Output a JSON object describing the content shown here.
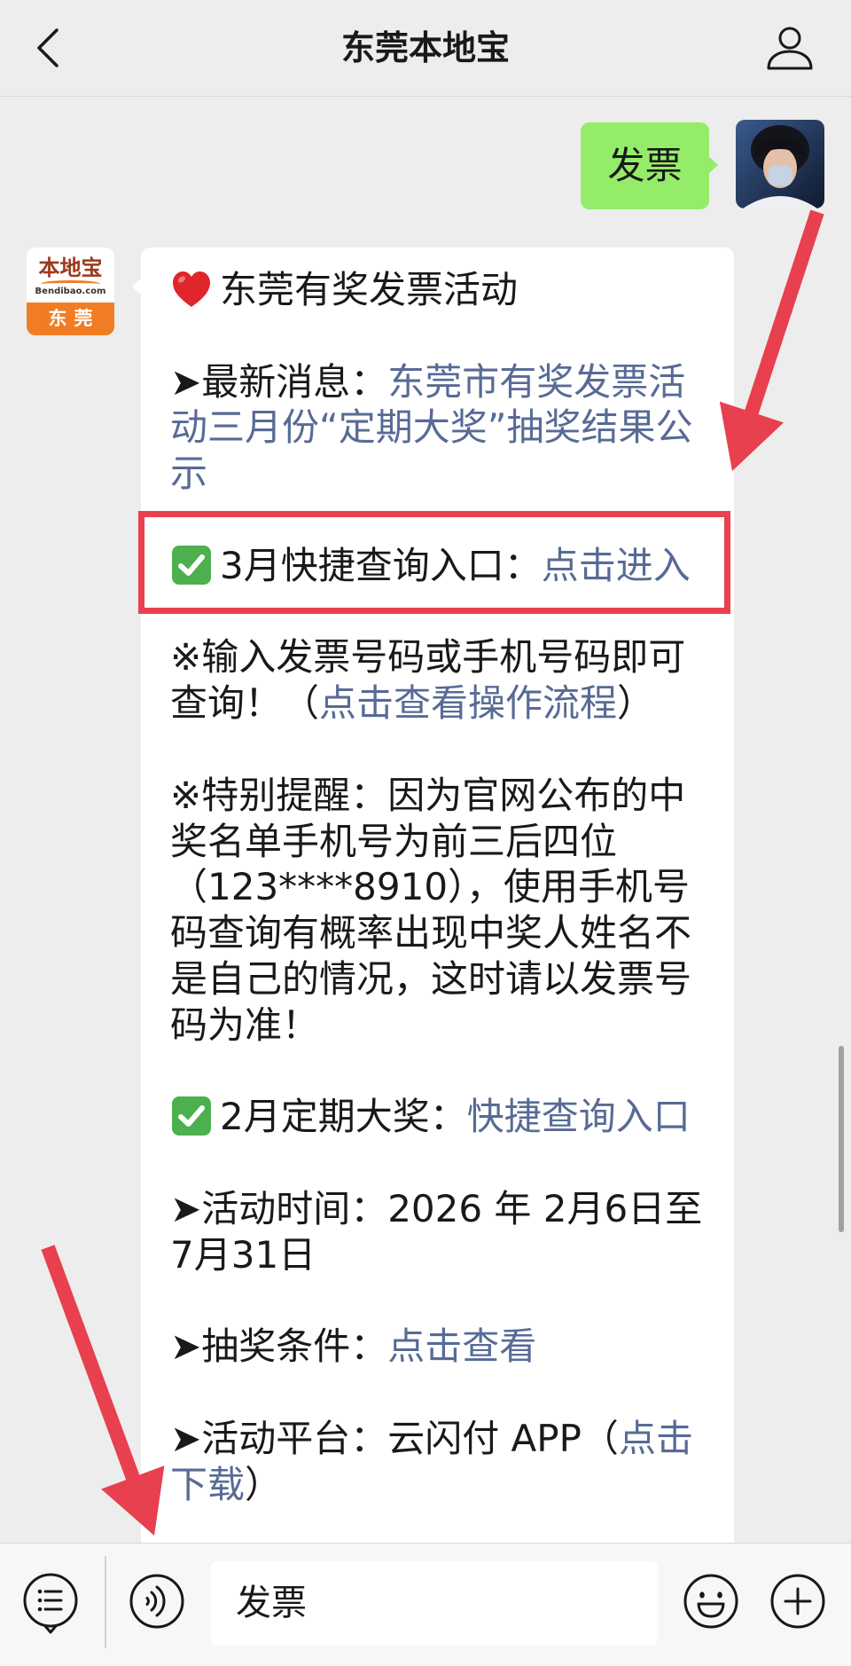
{
  "header": {
    "title": "东莞本地宝",
    "back_icon": "chevron-left-icon",
    "profile_icon": "person-icon"
  },
  "chat": {
    "user_message": {
      "text": "发票"
    },
    "bot_avatar": {
      "brand": "本地宝",
      "domain": "Bendibao.com",
      "city": "东莞"
    },
    "bot_message": {
      "title": {
        "icon": "heart-icon",
        "text": "东莞有奖发票活动"
      },
      "latest_news": {
        "label": "➤最新消息：",
        "link_lines": [
          "东莞市有奖发票活",
          "动三月份“定期大奖”抽奖结果公",
          "示"
        ]
      },
      "march_query": {
        "icon": "check-icon",
        "label": "3月快捷查询入口：",
        "link": "点击进入"
      },
      "input_tip": {
        "lines": [
          "※输入发票号码或手机号码即可",
          "查询！（"
        ],
        "link": "点击查看操作流程",
        "suffix": "）"
      },
      "reminder": {
        "lines": [
          "※特别提醒：因为官网公布的中",
          "奖名单手机号为前三后四位",
          "（123****8910），使用手机号",
          "码查询有概率出现中奖人姓名不",
          "是自己的情况，这时请以发票号",
          "码为准！"
        ]
      },
      "feb_prize": {
        "icon": "check-icon",
        "label": "2月定期大奖：",
        "link": "快捷查询入口"
      },
      "activity_time": {
        "lines": [
          "➤活动时间：2026 年 2月6日至",
          "7月31日"
        ]
      },
      "draw_conditions": {
        "label": "➤抽奖条件：",
        "link": "点击查看"
      },
      "platform": {
        "label": "➤活动平台：云闪付 APP（",
        "link_lines": [
          "点击",
          "下载"
        ],
        "suffix": "）"
      }
    }
  },
  "input_bar": {
    "menu_icon": "menu-list-icon",
    "voice_icon": "voice-icon",
    "input_value": "发票",
    "emoji_icon": "emoji-icon",
    "plus_icon": "plus-icon"
  },
  "colors": {
    "chat_background": "#ededed",
    "user_bubble": "#95ec69",
    "bot_bubble": "#ffffff",
    "link": "#576b95",
    "text": "#191919",
    "annotation_red": "#e8404f",
    "brand_orange": "#f07d23"
  }
}
